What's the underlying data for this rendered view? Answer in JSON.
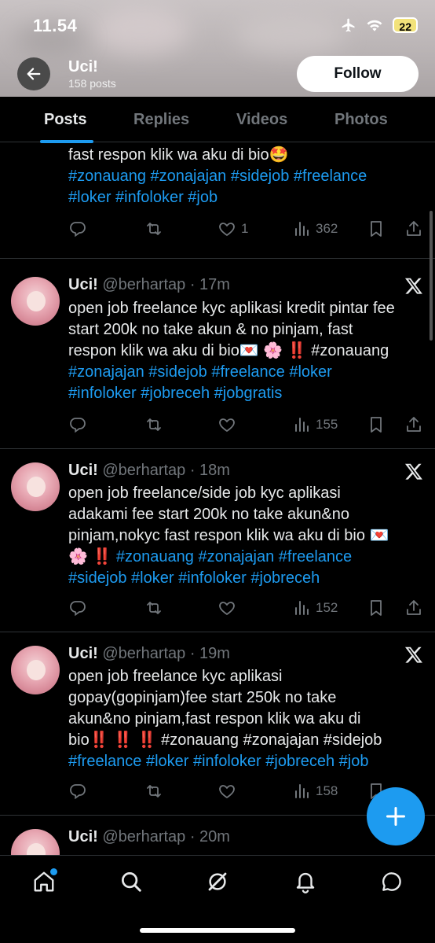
{
  "status_bar": {
    "time": "11.54",
    "battery": "22"
  },
  "profile": {
    "name": "Uci!",
    "posts_count": "158 posts",
    "follow_label": "Follow"
  },
  "tabs": [
    {
      "label": "Posts",
      "active": true
    },
    {
      "label": "Replies",
      "active": false
    },
    {
      "label": "Videos",
      "active": false
    },
    {
      "label": "Photos",
      "active": false
    }
  ],
  "tweets": [
    {
      "partial": true,
      "lines": [
        "fast respon klik wa aku di bio🤩",
        "#zonauang #zonajajan #sidejob #freelance",
        "#loker #infoloker #job"
      ],
      "metrics": {
        "replies": "",
        "reposts": "",
        "likes": "1",
        "views": "362"
      }
    },
    {
      "name": "Uci!",
      "handle": "@berhartap",
      "time": "· 17m",
      "lines": [
        "open job freelance kyc aplikasi kredit pintar fee",
        "start 200k  no take akun & no pinjam, fast",
        "respon klik wa aku di bio💌 🌸 ‼️ #zonauang",
        "#zonajajan #sidejob #freelance #loker",
        "#infoloker #jobreceh #jobgratis"
      ],
      "metrics": {
        "replies": "",
        "reposts": "",
        "likes": "",
        "views": "155"
      }
    },
    {
      "name": "Uci!",
      "handle": "@berhartap",
      "time": "· 18m",
      "lines": [
        "open job freelance/side job kyc aplikasi",
        "adakami fee start 200k no take akun&no",
        "pinjam,nokyc fast respon klik wa aku di bio 💌",
        "🌸 ‼️ #zonauang #zonajajan #freelance",
        "#sidejob #loker #infoloker #jobreceh"
      ],
      "metrics": {
        "replies": "",
        "reposts": "",
        "likes": "",
        "views": "152"
      }
    },
    {
      "name": "Uci!",
      "handle": "@berhartap",
      "time": "· 19m",
      "lines": [
        "open job freelance kyc aplikasi",
        "gopay(gopinjam)fee start 250k no take",
        "akun&no pinjam,fast respon klik wa aku di",
        "bio‼️ ‼️ ‼️ #zonauang #zonajajan #sidejob",
        "#freelance #loker #infoloker #jobreceh #job"
      ],
      "metrics": {
        "replies": "",
        "reposts": "",
        "likes": "",
        "views": "158"
      }
    },
    {
      "name": "Uci!",
      "handle": "@berhartap",
      "time": "· 20m",
      "lines": [],
      "metrics": {}
    }
  ],
  "colors": {
    "accent": "#1d9bf0",
    "background": "#000000",
    "muted": "#71767b",
    "text": "#e7e9ea"
  },
  "icons": {
    "bottom_nav": [
      "home-icon",
      "search-icon",
      "grok-icon",
      "notifications-icon",
      "messages-icon"
    ],
    "actions": [
      "reply-icon",
      "repost-icon",
      "like-icon",
      "views-icon",
      "bookmark-icon",
      "share-icon"
    ]
  }
}
